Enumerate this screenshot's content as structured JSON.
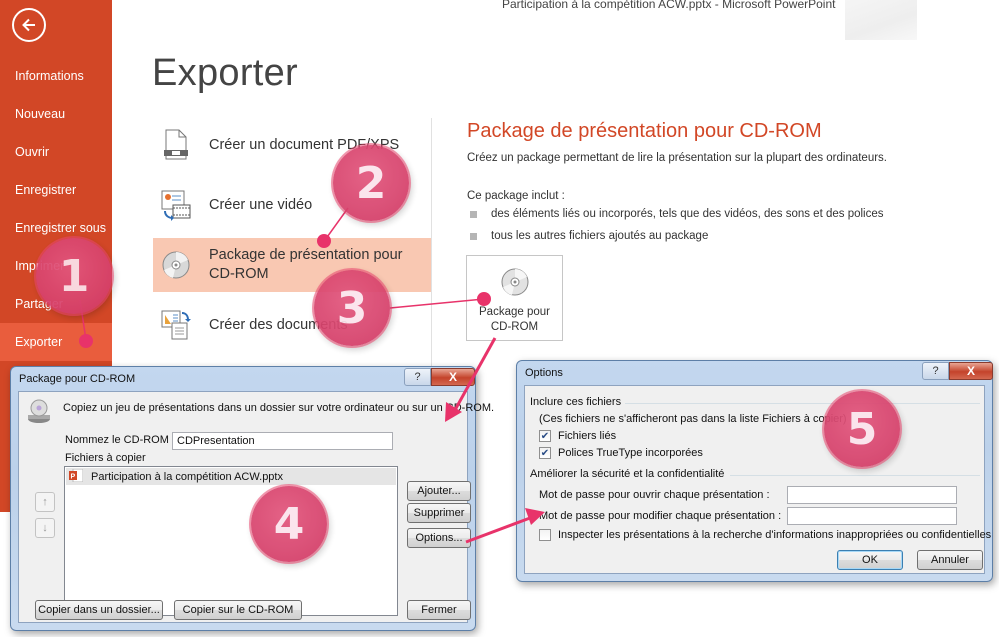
{
  "window": {
    "title": "Participation à la compétition ACW.pptx - Microsoft PowerPoint"
  },
  "sidebar": {
    "back_icon": "back-arrow-icon",
    "items": [
      {
        "label": "Informations",
        "active": false
      },
      {
        "label": "Nouveau",
        "active": false
      },
      {
        "label": "Ouvrir",
        "active": false
      },
      {
        "label": "Enregistrer",
        "active": false
      },
      {
        "label": "Enregistrer sous",
        "active": false
      },
      {
        "label": "Imprimer",
        "active": false
      },
      {
        "label": "Partager",
        "active": false
      },
      {
        "label": "Exporter",
        "active": true
      }
    ]
  },
  "main": {
    "title": "Exporter",
    "export_options": [
      {
        "label": "Créer un document PDF/XPS",
        "icon": "pdf-document-icon"
      },
      {
        "label": "Créer une vidéo",
        "icon": "video-icon"
      },
      {
        "label": "Package de présentation pour CD-ROM",
        "icon": "cd-icon",
        "selected": true
      },
      {
        "label": "Créer des documents",
        "icon": "handouts-icon"
      }
    ],
    "detail": {
      "title": "Package de présentation pour CD-ROM",
      "description": "Créez un package permettant de lire la présentation sur la plupart des ordinateurs.",
      "includes_label": "Ce package inclut :",
      "bullets": [
        "des éléments liés ou incorporés, tels que des vidéos, des sons et des polices",
        "tous les autres fichiers ajoutés au package"
      ],
      "button_label_line1": "Package pour",
      "button_label_line2": "CD-ROM"
    }
  },
  "package_dialog": {
    "title": "Package pour CD-ROM",
    "help": "?",
    "close": "X",
    "description": "Copiez un jeu de présentations dans un dossier sur votre ordinateur ou sur un CD-ROM.",
    "name_label": "Nommez le CD-ROM :",
    "name_value": "CDPresentation",
    "files_label": "Fichiers à copier",
    "files": [
      "Participation à la compétition ACW.pptx"
    ],
    "move_up": "↑",
    "move_down": "↓",
    "buttons": {
      "add": "Ajouter...",
      "remove": "Supprimer",
      "options": "Options...",
      "copy_folder": "Copier dans un dossier...",
      "copy_cd": "Copier sur le CD-ROM",
      "close": "Fermer"
    }
  },
  "options_dialog": {
    "title": "Options",
    "help": "?",
    "close": "X",
    "include_group": "Inclure ces fichiers",
    "include_note": "(Ces fichiers ne s'afficheront pas dans la liste Fichiers à copier)",
    "linked_files": {
      "label": "Fichiers liés",
      "checked": true
    },
    "truetype_fonts": {
      "label": "Polices TrueType incorporées",
      "checked": true
    },
    "security_group": "Améliorer la sécurité et la confidentialité",
    "open_password_label": "Mot de passe pour ouvrir chaque présentation :",
    "open_password_value": "",
    "modify_password_label": "Mot de passe pour modifier chaque présentation :",
    "modify_password_value": "",
    "inspect": {
      "label": "Inspecter les présentations à la recherche d'informations inappropriées ou confidentielles",
      "checked": false
    },
    "ok": "OK",
    "cancel": "Annuler"
  },
  "callouts": [
    "1",
    "2",
    "3",
    "4",
    "5"
  ],
  "colors": {
    "accent": "#d24726",
    "accent_active": "#e95d3d",
    "selected_bg": "#f9c8b2",
    "callout": "#d6406a",
    "arrow": "#e8336a"
  }
}
